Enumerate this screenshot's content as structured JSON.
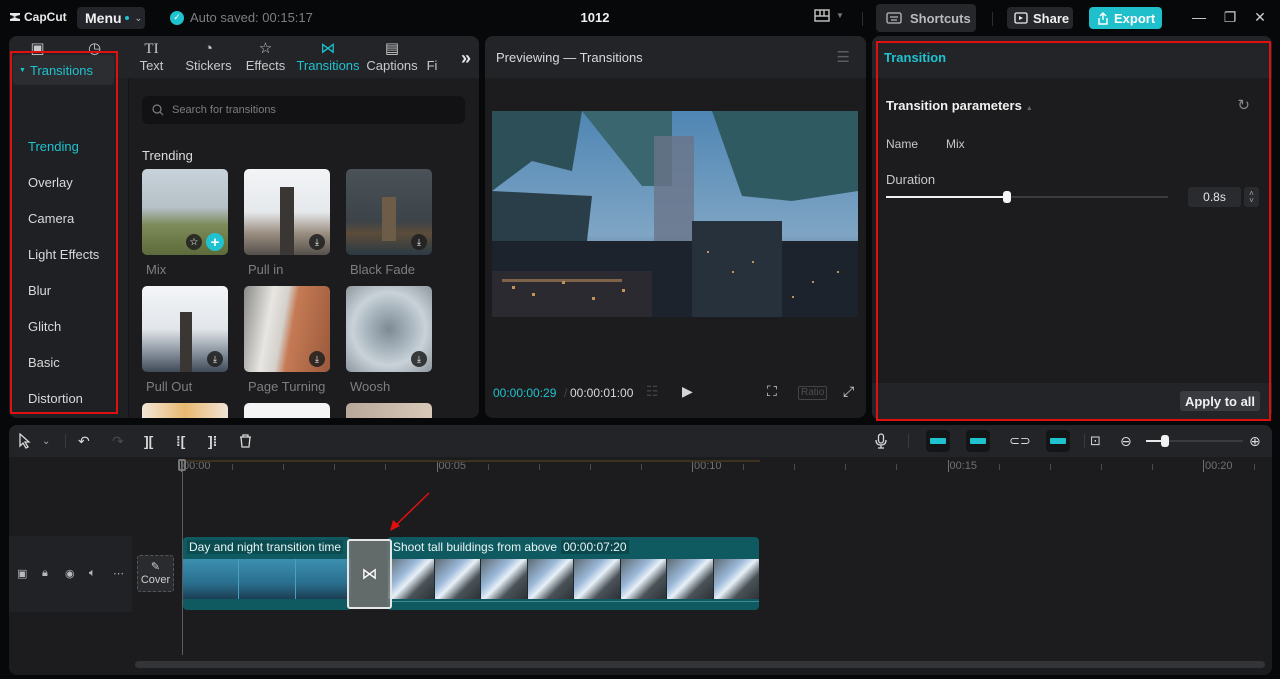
{
  "app": {
    "logo_text": "CapCut",
    "menu_label": "Menu",
    "autosave_text": "Auto saved: 00:15:17",
    "project_title": "1012",
    "shortcuts_label": "Shortcuts",
    "share_label": "Share",
    "export_label": "Export",
    "accent_color": "#1fc2cf"
  },
  "media_tabs": [
    {
      "label": "Import",
      "icon": "import-icon"
    },
    {
      "label": "Audio",
      "icon": "audio-icon"
    },
    {
      "label": "Text",
      "icon": "text-icon"
    },
    {
      "label": "Stickers",
      "icon": "stickers-icon"
    },
    {
      "label": "Effects",
      "icon": "effects-icon"
    },
    {
      "label": "Transitions",
      "icon": "transitions-icon",
      "active": true
    },
    {
      "label": "Captions",
      "icon": "captions-icon"
    },
    {
      "label": "Fi",
      "icon": "filters-icon"
    }
  ],
  "categories": {
    "header": "Transitions",
    "items": [
      "Trending",
      "Overlay",
      "Camera",
      "Light Effects",
      "Blur",
      "Glitch",
      "Basic",
      "Distortion"
    ],
    "active": "Trending"
  },
  "library": {
    "search_placeholder": "Search for transitions",
    "section_title": "Trending",
    "items": [
      {
        "name": "Mix"
      },
      {
        "name": "Pull in"
      },
      {
        "name": "Black Fade"
      },
      {
        "name": "Pull Out"
      },
      {
        "name": "Page Turning"
      },
      {
        "name": "Woosh"
      }
    ]
  },
  "preview": {
    "title": "Previewing — Transitions",
    "current_time": "00:00:00:29",
    "separator": "/",
    "total_time": "00:00:01:00",
    "ratio_label": "Ratio"
  },
  "inspector": {
    "tab_title": "Transition",
    "section_title": "Transition parameters",
    "name_label": "Name",
    "name_value": "Mix",
    "duration_label": "Duration",
    "duration_value": "0.8s",
    "duration_fraction": 0.43,
    "apply_all_label": "Apply to all"
  },
  "timeline": {
    "zoom_fraction": 0.2,
    "ruler_labels": [
      "00:00",
      "00:05",
      "00:10",
      "00:15",
      "00:20"
    ],
    "cover_label": "Cover",
    "clips": [
      {
        "title": "Day and night transition time",
        "duration": ""
      },
      {
        "title": "Shoot tall buildings from above",
        "duration": "00:00:07:20"
      }
    ]
  }
}
